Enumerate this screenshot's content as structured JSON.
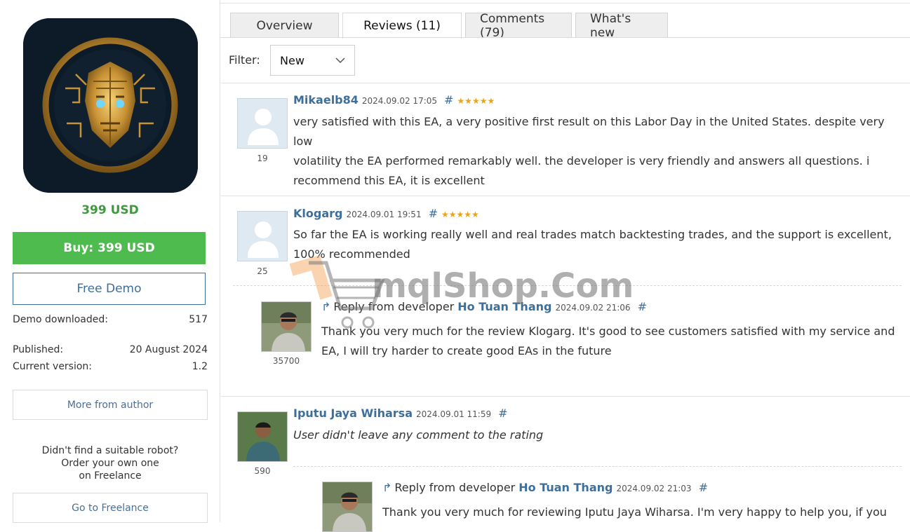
{
  "product": {
    "price": "399 USD",
    "buy_label": "Buy: 399 USD",
    "demo_label": "Free Demo",
    "info": [
      {
        "label": "Demo downloaded:",
        "value": "517"
      },
      {
        "label": "Published:",
        "value": "20 August 2024"
      },
      {
        "label": "Current version:",
        "value": "1.2"
      }
    ],
    "more_from_author": "More from author",
    "freelance_lines": [
      "Didn't find a suitable robot?",
      "Order your own one",
      "on Freelance"
    ],
    "go_to_freelance": "Go to Freelance",
    "logo_icon": "golden-robot-face-icon"
  },
  "tabs": [
    {
      "label": "Overview",
      "active": false
    },
    {
      "label": "Reviews (11)",
      "active": true
    },
    {
      "label": "Comments (79)",
      "active": false
    },
    {
      "label": "What's new",
      "active": false
    }
  ],
  "filter": {
    "label": "Filter:",
    "value": "New"
  },
  "reviews": [
    {
      "author": "Mikaelb84",
      "date": "2024.09.02 17:05",
      "hash": "#",
      "stars": "★★★★★",
      "count": "19",
      "lines": [
        "very satisfied with this EA, a very positive first result on this Labor Day in the United States. despite very low",
        "volatility the EA performed remarkably well. the developer is very friendly and answers all questions. i",
        "recommend this EA, it is excellent"
      ]
    },
    {
      "author": "Klogarg",
      "date": "2024.09.01 19:51",
      "hash": "#",
      "stars": "★★★★★",
      "count": "25",
      "lines": [
        "So far the EA is working really well and real trades match backtesting trades, and the support is excellent,",
        "100% recommended"
      ],
      "reply": {
        "prefix": "Reply from developer",
        "developer": "Ho Tuan Thang",
        "date": "2024.09.02 21:06",
        "hash": "#",
        "count": "35700",
        "lines": [
          "Thank you very much for the review Klogarg. It's good to see customers satisfied with my service and",
          "EA, I will try harder to create good EAs in the future"
        ]
      }
    },
    {
      "author": "Iputu Jaya Wiharsa",
      "date": "2024.09.01 11:59",
      "hash": "#",
      "count": "590",
      "lines": [
        "User didn't leave any comment to the rating"
      ],
      "reply": {
        "prefix": "Reply from developer",
        "developer": "Ho Tuan Thang",
        "date": "2024.09.02 21:03",
        "hash": "#",
        "lines": [
          "Thank you very much for reviewing Iputu Jaya Wiharsa. I'm very happy to help you, if you"
        ]
      }
    }
  ],
  "watermark": "mqlShop.Com",
  "colors": {
    "buy": "#4dbb4d",
    "price": "#3c9b3c",
    "link": "#3e6f9b",
    "star": "#f0a30a"
  }
}
